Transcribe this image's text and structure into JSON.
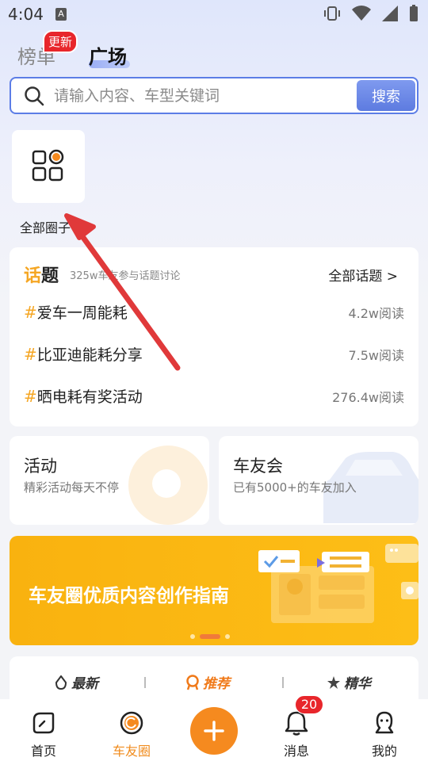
{
  "status_bar": {
    "time": "4:04",
    "a_icon": "A"
  },
  "tabs": {
    "bangdan": "榜单",
    "guangchang": "广场",
    "update_badge": "更新"
  },
  "search": {
    "placeholder": "请输入内容、车型关键词",
    "button": "搜索"
  },
  "all_circles": {
    "label": "全部圈子"
  },
  "topics": {
    "logo_hua": "话",
    "logo_ti": "题",
    "subtitle": "325w车友参与话题讨论",
    "all_link": "全部话题 >",
    "hash": "#",
    "items": [
      {
        "name": "爱车一周能耗",
        "reads": "4.2w阅读"
      },
      {
        "name": "比亚迪能耗分享",
        "reads": "7.5w阅读"
      },
      {
        "name": "晒电耗有奖活动",
        "reads": "276.4w阅读"
      }
    ]
  },
  "activity_card": {
    "title": "活动",
    "desc": "精彩活动每天不停"
  },
  "club_card": {
    "title": "车友会",
    "desc": "已有5000+的车友加入"
  },
  "banner": {
    "text": "车友圈优质内容创作指南"
  },
  "feed_tabs": {
    "latest": "最新",
    "recommend": "推荐",
    "best": "精华"
  },
  "bottom_nav": {
    "home": "首页",
    "circle": "车友圈",
    "messages": "消息",
    "me": "我的",
    "message_count": "20"
  },
  "colors": {
    "accent": "#f58a1f",
    "brand_blue": "#5c7de6",
    "badge_red": "#e8262b",
    "banner_yellow": "#fdbe17"
  }
}
